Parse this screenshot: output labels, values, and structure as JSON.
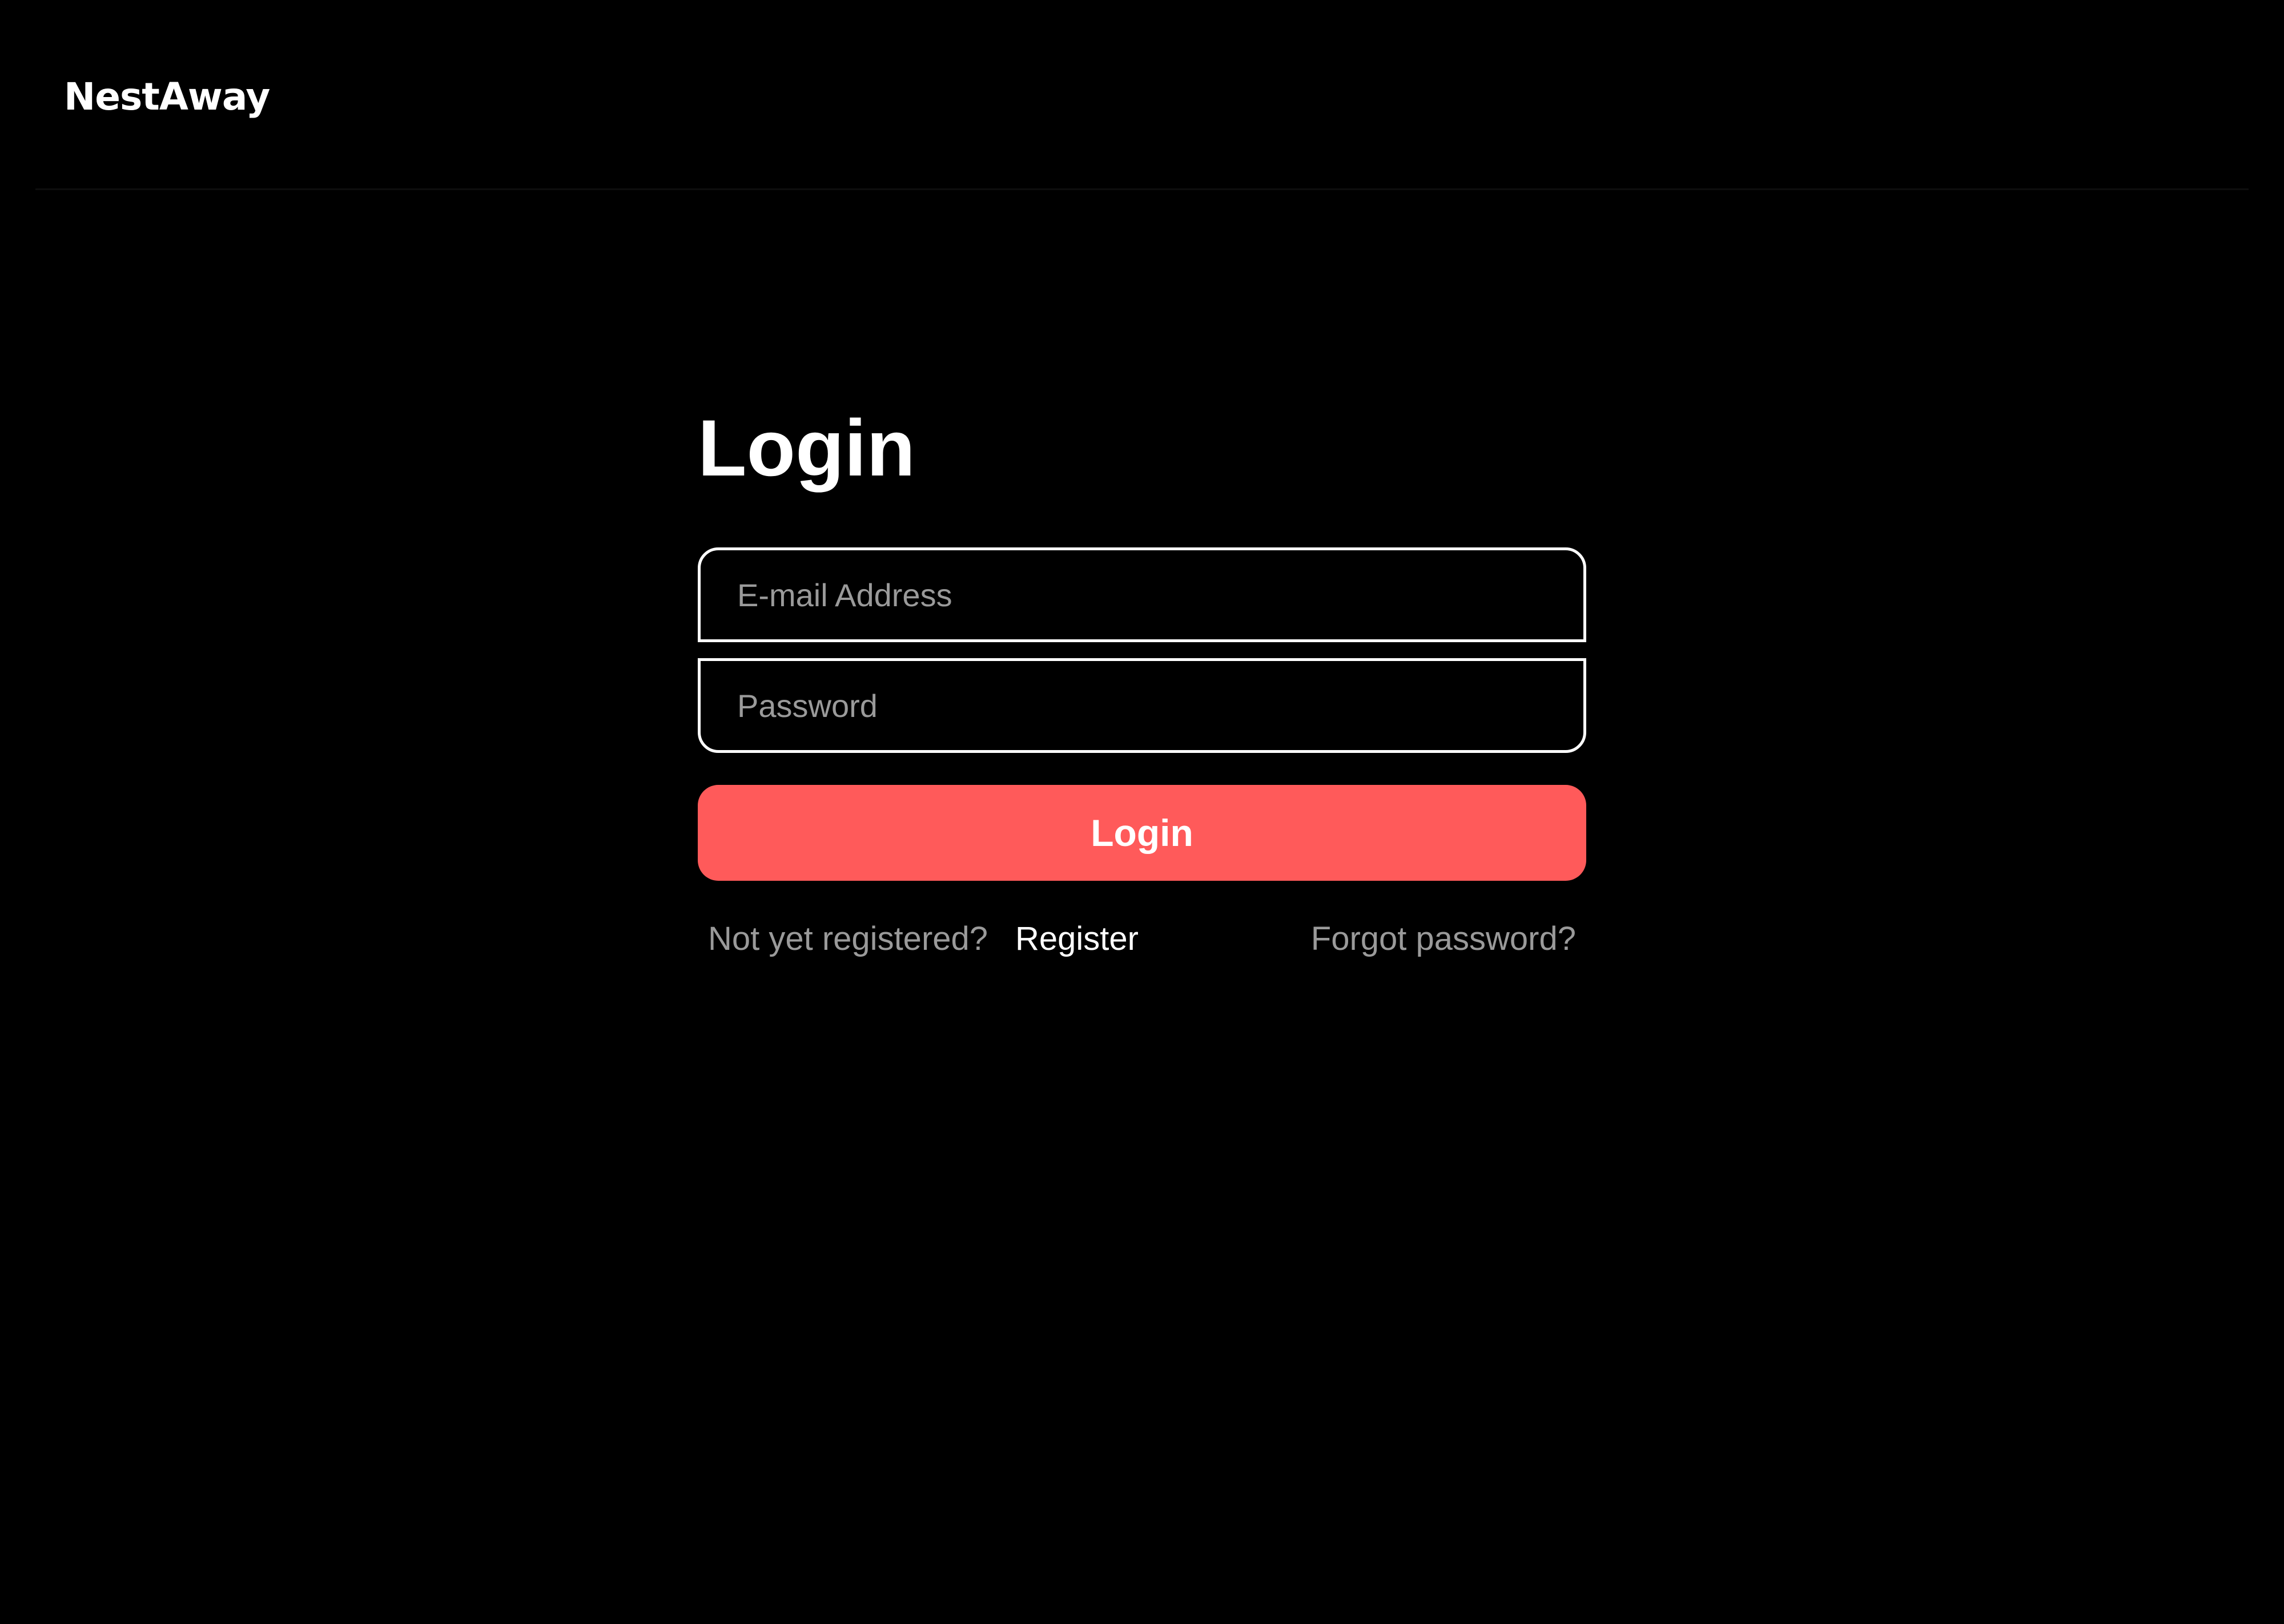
{
  "header": {
    "brand": "NestAway"
  },
  "login": {
    "title": "Login",
    "email_placeholder": "E-mail Address",
    "password_placeholder": "Password",
    "submit_label": "Login",
    "not_registered_text": "Not yet registered?",
    "register_label": "Register",
    "forgot_label": "Forgot password?"
  },
  "colors": {
    "background": "#000000",
    "accent": "#ff5a5a",
    "text_primary": "#ffffff",
    "text_muted": "#9a9a9a"
  }
}
